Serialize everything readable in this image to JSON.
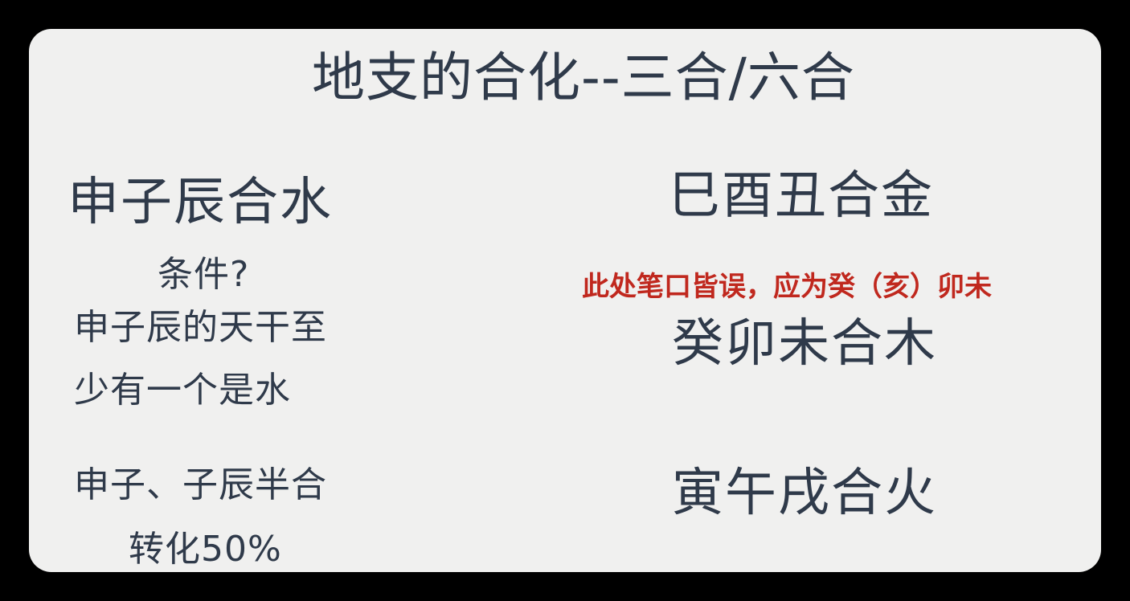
{
  "title": "地支的合化--三合/六合",
  "left": {
    "heading": "申子辰合水",
    "condition_label": "条件?",
    "condition_line1": "申子辰的天干至",
    "condition_line2": "少有一个是水",
    "half_combo_line1": "申子、子辰半合",
    "half_combo_line2": "转化50%"
  },
  "right": {
    "metal": "巳酉丑合金",
    "correction_note": "此处笔口皆误，应为癸（亥）卯未",
    "wood": "癸卯未合木",
    "fire": "寅午戌合火"
  },
  "colors": {
    "text": "#2f3a4a",
    "note": "#c0281e",
    "slide_bg": "#f0f0ef",
    "frame_bg": "#000000"
  }
}
